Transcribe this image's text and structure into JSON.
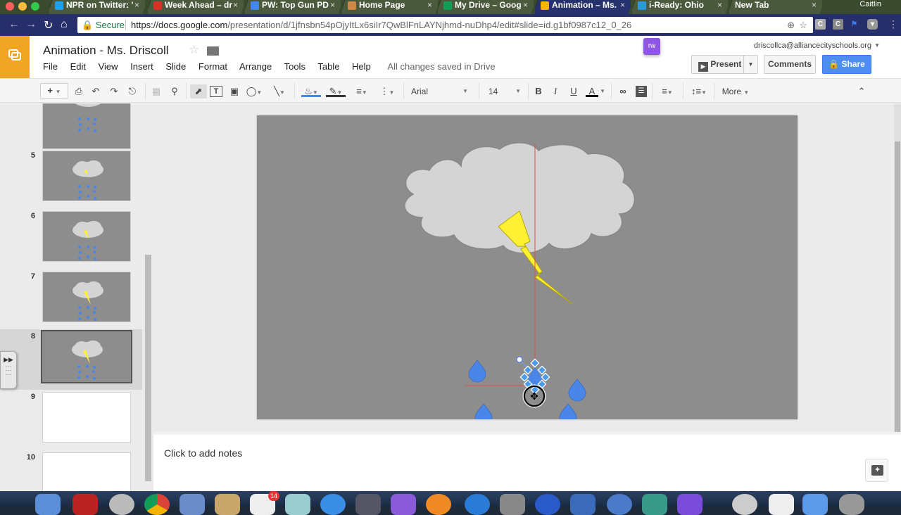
{
  "browser": {
    "tabs": [
      {
        "label": "NPR on Twitter: '",
        "favicon": "twitter-icon",
        "active": false
      },
      {
        "label": "Week Ahead – dr",
        "favicon": "gmail-icon",
        "active": false
      },
      {
        "label": "PW: Top Gun PD",
        "favicon": "google-docs-icon",
        "active": false
      },
      {
        "label": "Home Page",
        "favicon": "globe-icon",
        "active": false
      },
      {
        "label": "My Drive – Goog",
        "favicon": "google-drive-icon",
        "active": false
      },
      {
        "label": "Animation – Ms.",
        "favicon": "google-slides-icon",
        "active": true
      },
      {
        "label": "i-Ready: Ohio",
        "favicon": "iready-icon",
        "active": false
      },
      {
        "label": "New Tab",
        "favicon": "",
        "active": false
      }
    ],
    "tab_close_glyph": "×",
    "user_name": "Caitlin",
    "secure_label": "Secure",
    "url_host": "https://docs.google.com",
    "url_path": "/presentation/d/1jfnsbn54pOjyItLx6siIr7QwBlFnLAYNjhmd-nuDhp4/edit#slide=id.g1bf0987c12_0_26",
    "extensions": [
      "C",
      "C",
      "⚑",
      "▾"
    ]
  },
  "app": {
    "doc_title": "Animation - Ms. Driscoll",
    "menu": [
      "File",
      "Edit",
      "View",
      "Insert",
      "Slide",
      "Format",
      "Arrange",
      "Tools",
      "Table",
      "Help"
    ],
    "save_status": "All changes saved in Drive",
    "account_email": "driscollca@alliancecityschools.org",
    "rw_extension_label": "rw",
    "present_label": "Present",
    "comments_label": "Comments",
    "share_label": "Share",
    "accent_color": "#f0a524",
    "share_color": "#4d8ef0"
  },
  "toolbar": {
    "font_name": "Arial",
    "font_size": "14",
    "bold": "B",
    "italic": "I",
    "underline": "U",
    "text_color": "A",
    "more_label": "More"
  },
  "filmstrip": {
    "slides": [
      {
        "number": "",
        "type": "rain",
        "lightning": 0
      },
      {
        "number": "5",
        "type": "rain",
        "lightning": 1
      },
      {
        "number": "6",
        "type": "rain",
        "lightning": 2
      },
      {
        "number": "7",
        "type": "rain",
        "lightning": 3
      },
      {
        "number": "8",
        "type": "rain",
        "lightning": 3,
        "selected": true
      },
      {
        "number": "9",
        "type": "blank"
      },
      {
        "number": "10",
        "type": "blank"
      }
    ]
  },
  "slide": {
    "background": "#8d8d8d",
    "cloud_color": "#d4d4d4",
    "lightning_color": "#fff033",
    "raindrop_color": "#4a86e8",
    "guide_color": "#e0504a"
  },
  "notes": {
    "placeholder": "Click to add notes"
  },
  "dock": {
    "calendar_badge": "14"
  }
}
